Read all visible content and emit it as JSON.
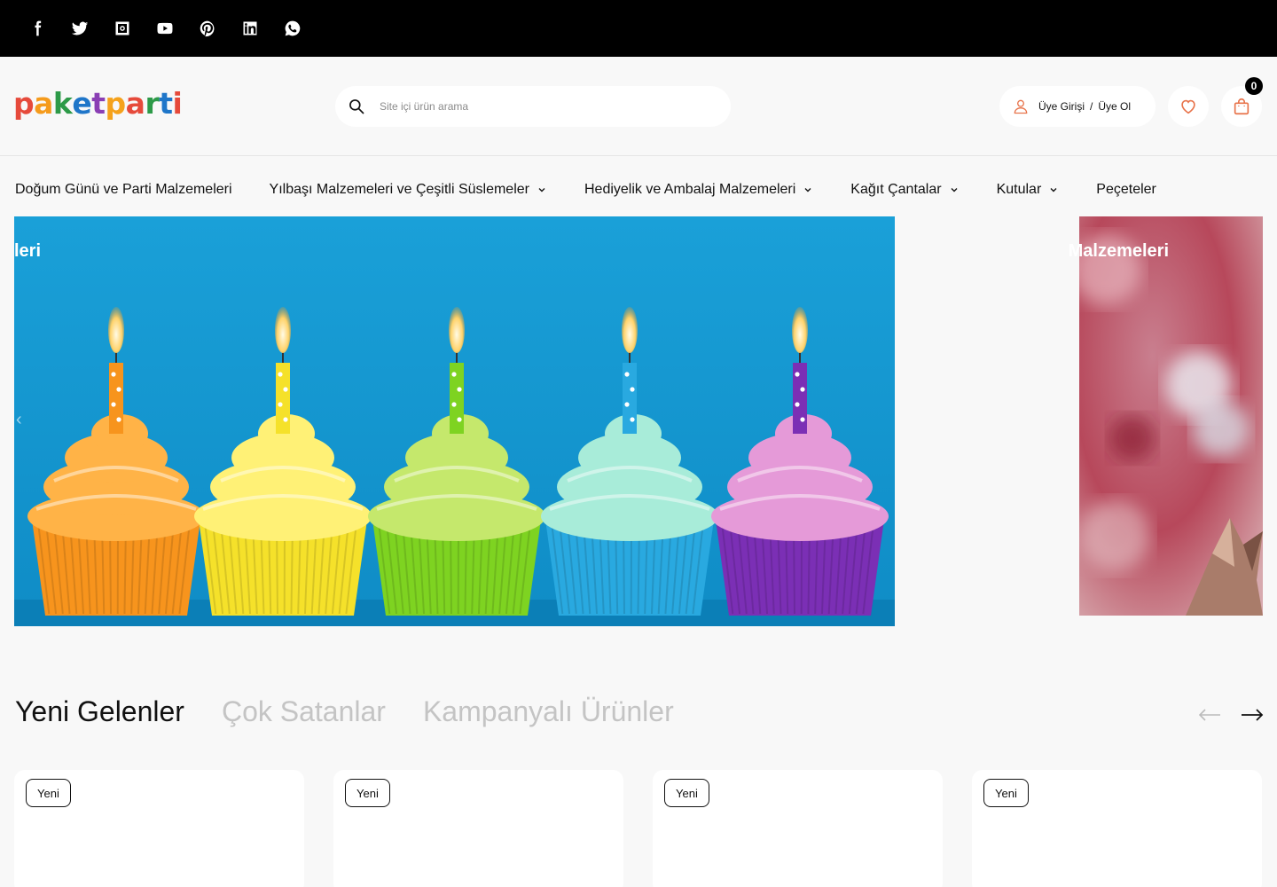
{
  "social": [
    {
      "name": "facebook-icon"
    },
    {
      "name": "twitter-icon"
    },
    {
      "name": "instagram-icon"
    },
    {
      "name": "youtube-icon"
    },
    {
      "name": "pinterest-icon"
    },
    {
      "name": "linkedin-icon"
    },
    {
      "name": "whatsapp-icon"
    }
  ],
  "logo": {
    "letters": [
      "p",
      "a",
      "k",
      "e",
      "t",
      "p",
      "a",
      "r",
      "t",
      "i"
    ],
    "colors": [
      "#e64a3b",
      "#f59b1c",
      "#2d9a48",
      "#1f76c9",
      "#8a3fb4",
      "#f5a21c",
      "#e64a3b",
      "#2d9a48",
      "#1f76c9",
      "#e64a3b"
    ]
  },
  "search": {
    "placeholder": "Site içi ürün arama"
  },
  "account": {
    "login": "Üye Girişi",
    "separator": "/",
    "register": "Üye Ol"
  },
  "cart": {
    "count": "0"
  },
  "nav": {
    "items": [
      {
        "label": "Doğum Günü ve Parti Malzemeleri",
        "has_dropdown": false
      },
      {
        "label": "Yılbaşı Malzemeleri ve Çeşitli Süslemeler",
        "has_dropdown": true
      },
      {
        "label": "Hediyelik ve Ambalaj Malzemeleri",
        "has_dropdown": true
      },
      {
        "label": "Kağıt Çantalar",
        "has_dropdown": true
      },
      {
        "label": "Kutular",
        "has_dropdown": true
      },
      {
        "label": "Peçeteler",
        "has_dropdown": false
      }
    ]
  },
  "hero": {
    "left_caption": "leri",
    "right_caption": "Malzemeleri",
    "cupcake_colors": [
      "#f7941d",
      "#f5e12a",
      "#7ed321",
      "#29a9e0",
      "#7b2fb5"
    ],
    "frosting_colors": [
      "#ffb347",
      "#fff176",
      "#c5e86c",
      "#a8ecd9",
      "#e59ad8"
    ]
  },
  "section": {
    "tabs": [
      "Yeni Gelenler",
      "Çok Satanlar",
      "Kampanyalı Ürünler"
    ]
  },
  "products": [
    {
      "badge": "Yeni"
    },
    {
      "badge": "Yeni"
    },
    {
      "badge": "Yeni"
    },
    {
      "badge": "Yeni"
    }
  ],
  "colors": {
    "accent": "#e8734a",
    "background": "#f8f8f8"
  }
}
